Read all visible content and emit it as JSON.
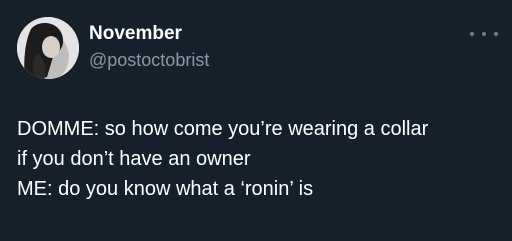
{
  "user": {
    "display_name": "November",
    "handle": "@postoctobrist",
    "avatar_icon": "profile-photo"
  },
  "menu": {
    "icon": "more-options-icon"
  },
  "tweet": {
    "lines": [
      "DOMME: so how come you’re wearing a collar",
      "if you don’t have an owner",
      "ME: do you know what a ‘ronin’ is"
    ]
  },
  "colors": {
    "background": "#15202b",
    "primary_text": "#ffffff",
    "secondary_text": "#8b98a5"
  }
}
